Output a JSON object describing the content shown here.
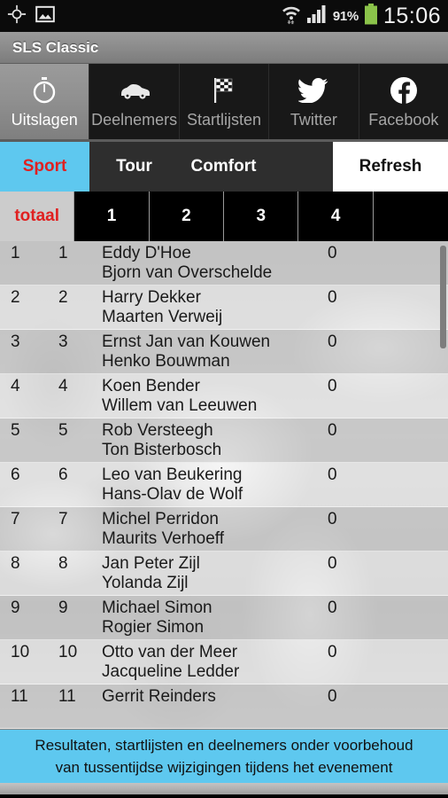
{
  "statusbar": {
    "icons_left": [
      "gps-crosshair-icon",
      "screenshot-image-icon"
    ],
    "icons_right": [
      "wifi-icon",
      "signal-bars-icon",
      "battery-icon"
    ],
    "battery_percent": "91%",
    "clock": "15:06"
  },
  "titlebar": {
    "title": "SLS Classic"
  },
  "tabs": [
    {
      "label": "Uitslagen",
      "icon": "stopwatch-icon",
      "active": true
    },
    {
      "label": "Deelnemers",
      "icon": "car-icon",
      "active": false
    },
    {
      "label": "Startlijsten",
      "icon": "checkered-flag-icon",
      "active": false
    },
    {
      "label": "Twitter",
      "icon": "twitter-bird-icon",
      "active": false
    },
    {
      "label": "Facebook",
      "icon": "facebook-icon",
      "active": false
    }
  ],
  "categories": {
    "items": [
      {
        "label": "Sport",
        "selected": true
      },
      {
        "label": "Tour",
        "selected": false
      },
      {
        "label": "Comfort",
        "selected": false
      }
    ],
    "refresh_label": "Refresh"
  },
  "stages": [
    {
      "label": "totaal",
      "selected": true
    },
    {
      "label": "1",
      "selected": false
    },
    {
      "label": "2",
      "selected": false
    },
    {
      "label": "3",
      "selected": false
    },
    {
      "label": "4",
      "selected": false
    }
  ],
  "results": [
    {
      "pos": "1",
      "num": "1",
      "driver": "Eddy  D'Hoe",
      "codriver": "Bjorn  van Overschelde",
      "score": "0"
    },
    {
      "pos": "2",
      "num": "2",
      "driver": "Harry  Dekker",
      "codriver": "Maarten  Verweij",
      "score": "0"
    },
    {
      "pos": "3",
      "num": "3",
      "driver": "Ernst Jan  van Kouwen",
      "codriver": "Henko  Bouwman",
      "score": "0"
    },
    {
      "pos": "4",
      "num": "4",
      "driver": "Koen  Bender",
      "codriver": "Willem  van Leeuwen",
      "score": "0"
    },
    {
      "pos": "5",
      "num": "5",
      "driver": "Rob  Versteegh",
      "codriver": "Ton  Bisterbosch",
      "score": "0"
    },
    {
      "pos": "6",
      "num": "6",
      "driver": "Leo   van Beukering",
      "codriver": "Hans-Olav  de Wolf",
      "score": "0"
    },
    {
      "pos": "7",
      "num": "7",
      "driver": "Michel  Perridon",
      "codriver": "Maurits  Verhoeff",
      "score": "0"
    },
    {
      "pos": "8",
      "num": "8",
      "driver": "Jan Peter  Zijl",
      "codriver": "Yolanda  Zijl",
      "score": "0"
    },
    {
      "pos": "9",
      "num": "9",
      "driver": "Michael  Simon",
      "codriver": "Rogier  Simon",
      "score": "0"
    },
    {
      "pos": "10",
      "num": "10",
      "driver": "Otto  van der Meer",
      "codriver": "Jacqueline  Ledder",
      "score": "0"
    },
    {
      "pos": "11",
      "num": "11",
      "driver": "Gerrit  Reinders",
      "codriver": "",
      "score": "0"
    }
  ],
  "footer": {
    "line1": "Resultaten, startlijsten en deelnemers onder voorbehoud",
    "line2": "van tussentijdse wijzigingen tijdens het evenement"
  },
  "colors": {
    "accent_blue": "#5ec8ef",
    "selected_red": "#e02020",
    "titlebar_gray": "#8d8d8d",
    "battery_green": "#8bc34a"
  }
}
